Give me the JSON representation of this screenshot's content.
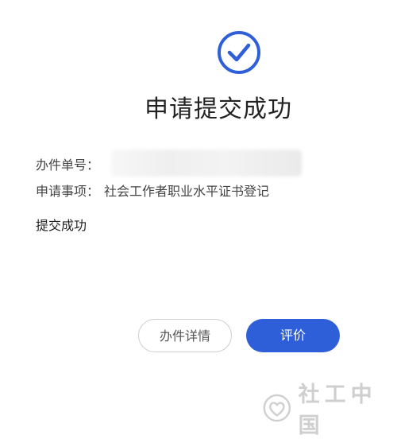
{
  "result": {
    "title": "申请提交成功",
    "number_label": "办件单号：",
    "item_label": "申请事项：",
    "item_value": "社会工作者职业水平证书登记",
    "status_text": "提交成功"
  },
  "actions": {
    "detail_label": "办件详情",
    "rate_label": "评价"
  },
  "watermark": {
    "text": "社工中国"
  },
  "colors": {
    "accent": "#2f5fd8",
    "check_icon": "#2f5fd8",
    "button_border": "#cfcfcf",
    "watermark": "#cfcfcf"
  },
  "icons": {
    "success": "check-circle-icon",
    "watermark_logo": "heart-logo-icon"
  }
}
